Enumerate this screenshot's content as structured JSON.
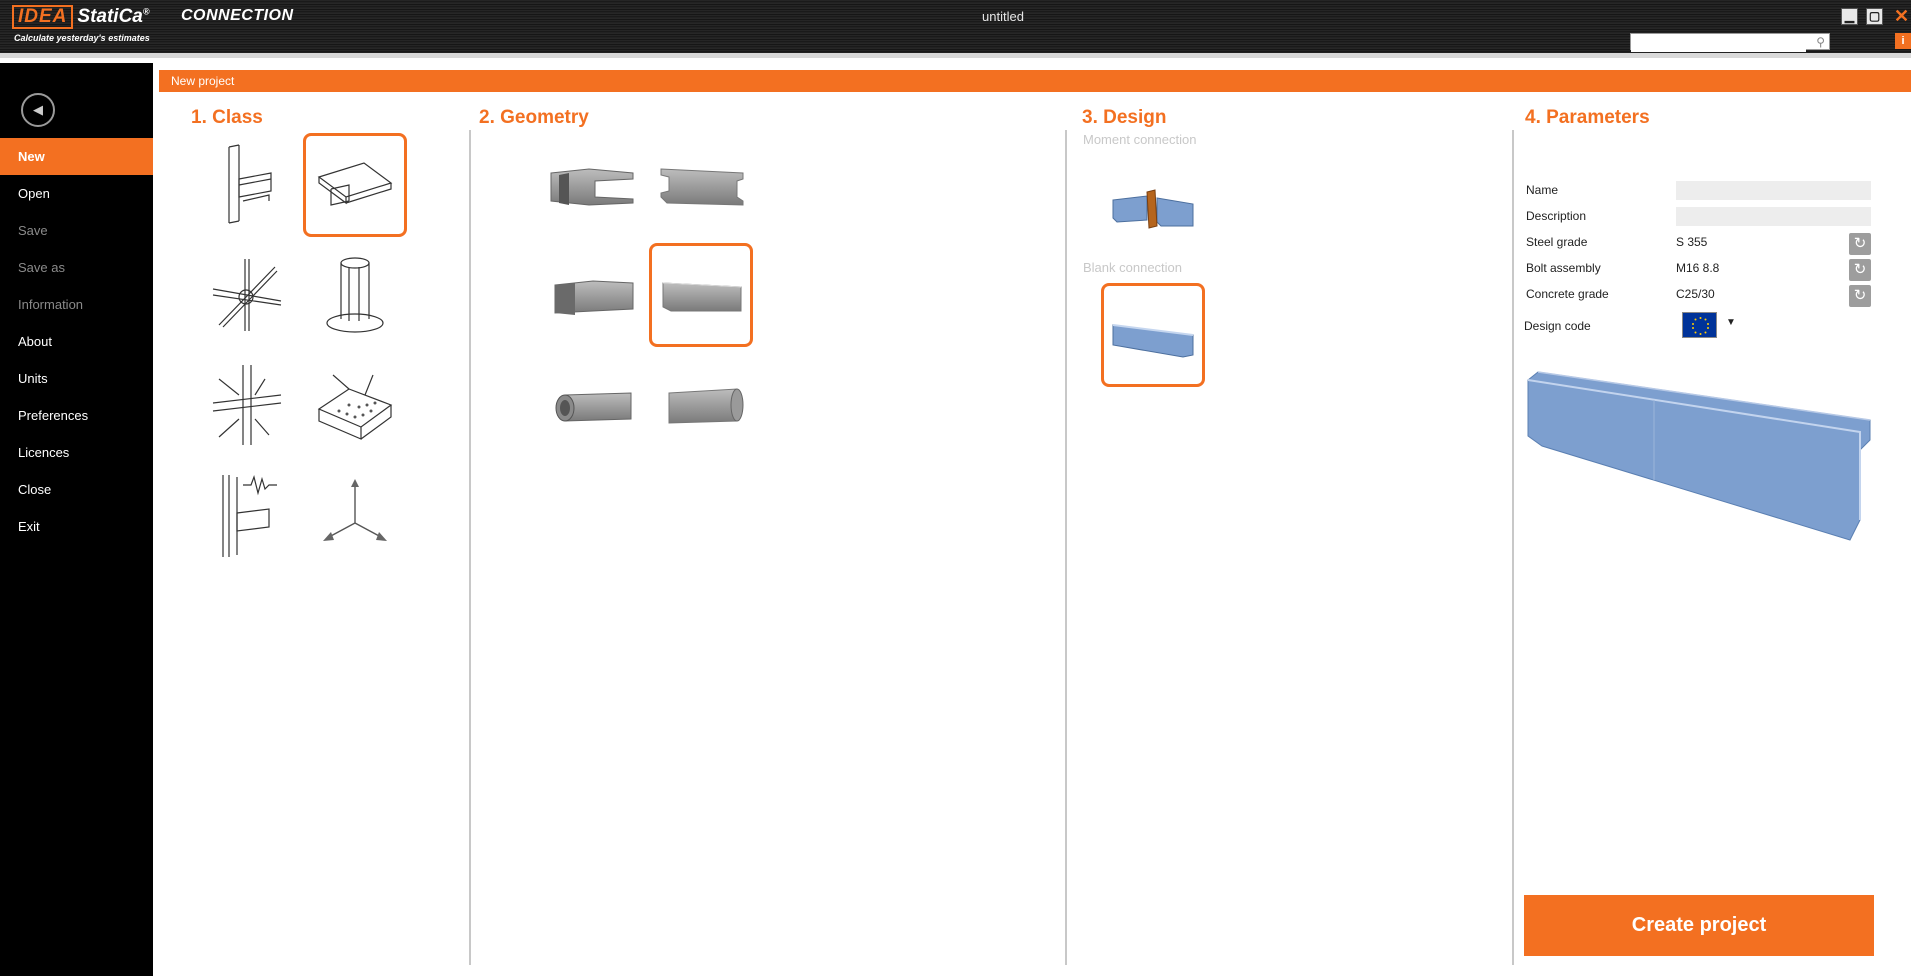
{
  "app": {
    "logo_brand": "IDEA",
    "logo_product": "StatiCa",
    "logo_mark": "®",
    "name": "CONNECTION",
    "tagline": "Calculate yesterday's estimates",
    "document_title": "untitled"
  },
  "search": {
    "placeholder": "",
    "value": ""
  },
  "window_controls": {
    "minimize": "▁",
    "maximize": "▢",
    "close": "✕",
    "info": "i"
  },
  "sidebar": {
    "back_glyph": "◀",
    "items": [
      {
        "label": "New",
        "state": "active"
      },
      {
        "label": "Open",
        "state": "enabled"
      },
      {
        "label": "Save",
        "state": "disabled"
      },
      {
        "label": "Save as",
        "state": "disabled"
      },
      {
        "label": "Information",
        "state": "disabled"
      },
      {
        "label": "About",
        "state": "enabled"
      },
      {
        "label": "Units",
        "state": "enabled"
      },
      {
        "label": "Preferences",
        "state": "enabled"
      },
      {
        "label": "Licences",
        "state": "enabled"
      },
      {
        "label": "Close",
        "state": "enabled"
      },
      {
        "label": "Exit",
        "state": "enabled"
      }
    ]
  },
  "header": {
    "title": "New project"
  },
  "columns": {
    "class": {
      "title": "1.  Class"
    },
    "geometry": {
      "title": "2. Geometry"
    },
    "design": {
      "title": "3. Design",
      "moment_label": "Moment connection",
      "blank_label": "Blank connection"
    },
    "parameters": {
      "title": "4. Parameters"
    }
  },
  "parameters": {
    "name": {
      "label": "Name",
      "value": ""
    },
    "description": {
      "label": "Description",
      "value": ""
    },
    "steel_grade": {
      "label": "Steel grade",
      "value": "S 355"
    },
    "bolt_assembly": {
      "label": "Bolt assembly",
      "value": "M16 8.8"
    },
    "concrete_grade": {
      "label": "Concrete grade",
      "value": "C25/30"
    },
    "design_code": {
      "label": "Design code",
      "flag": "eu-flag-icon"
    },
    "reset_glyph": "↻",
    "dropdown_glyph": "▼"
  },
  "actions": {
    "create_project": "Create project"
  },
  "colors": {
    "accent": "#f37021",
    "sidebar_bg": "#000000",
    "steel_blue": "#7d9fcf"
  }
}
